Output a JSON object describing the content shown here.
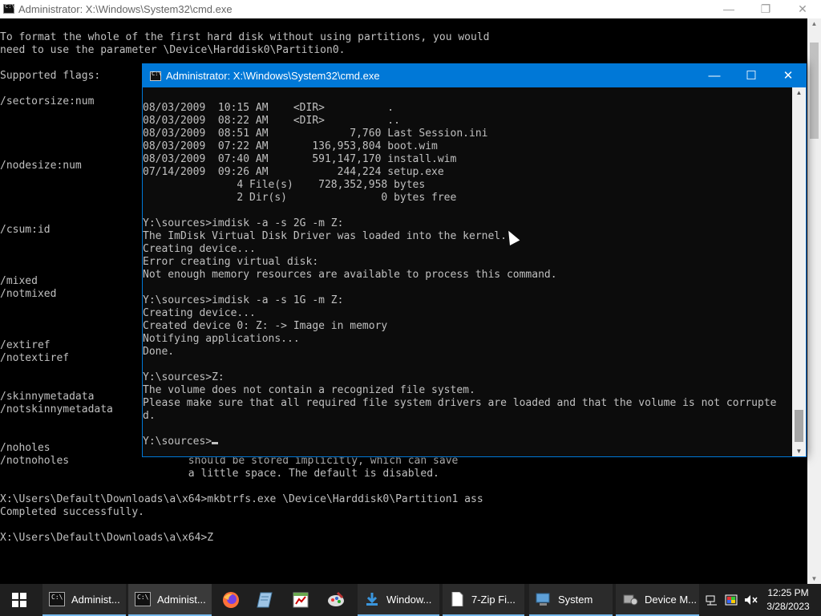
{
  "background_window": {
    "title": "Administrator: X:\\Windows\\System32\\cmd.exe",
    "lines": [
      "To format the whole of the first hard disk without using partitions, you would",
      "need to use the parameter \\Device\\Harddisk0\\Partition0.",
      "",
      "Supported flags:",
      "",
      "/sectorsize:num",
      "",
      "",
      "",
      "",
      "/nodesize:num",
      "",
      "",
      "",
      "",
      "/csum:id",
      "",
      "",
      "",
      "/mixed",
      "/notmixed",
      "",
      "",
      "",
      "/extiref",
      "/notextiref",
      "",
      "",
      "/skinnymetadata",
      "/notskinnymetadata",
      "",
      "",
      "/noholes",
      "/notnoholes                   should be stored implicitly, which can save",
      "                              a little space. The default is disabled.",
      "",
      "X:\\Users\\Default\\Downloads\\a\\x64>mkbtrfs.exe \\Device\\Harddisk0\\Partition1 ass",
      "Completed successfully.",
      "",
      "X:\\Users\\Default\\Downloads\\a\\x64>Z"
    ]
  },
  "foreground_window": {
    "title": "Administrator: X:\\Windows\\System32\\cmd.exe",
    "lines": [
      "08/03/2009  10:15 AM    <DIR>          .",
      "08/03/2009  08:22 AM    <DIR>          ..",
      "08/03/2009  08:51 AM             7,760 Last Session.ini",
      "08/03/2009  07:22 AM       136,953,804 boot.wim",
      "08/03/2009  07:40 AM       591,147,170 install.wim",
      "07/14/2009  09:26 AM           244,224 setup.exe",
      "               4 File(s)    728,352,958 bytes",
      "               2 Dir(s)               0 bytes free",
      "",
      "Y:\\sources>imdisk -a -s 2G -m Z:",
      "The ImDisk Virtual Disk Driver was loaded into the kernel.",
      "Creating device...",
      "Error creating virtual disk:",
      "Not enough memory resources are available to process this command.",
      "",
      "Y:\\sources>imdisk -a -s 1G -m Z:",
      "Creating device...",
      "Created device 0: Z: -> Image in memory",
      "Notifying applications...",
      "Done.",
      "",
      "Y:\\sources>Z:",
      "The volume does not contain a recognized file system.",
      "Please make sure that all required file system drivers are loaded and that the volume is not corrupte",
      "d.",
      ""
    ],
    "prompt": "Y:\\sources>"
  },
  "taskbar": {
    "apps": [
      {
        "label": "Administ...",
        "icon": "cmd-icon",
        "state": "open"
      },
      {
        "label": "Administ...",
        "icon": "cmd-icon",
        "state": "active"
      },
      {
        "label": "",
        "icon": "firefox-icon",
        "state": "pinned"
      },
      {
        "label": "",
        "icon": "notepad-icon",
        "state": "pinned"
      },
      {
        "label": "",
        "icon": "spreadsheet-icon",
        "state": "pinned"
      },
      {
        "label": "",
        "icon": "paint-icon",
        "state": "pinned"
      },
      {
        "label": "Window...",
        "icon": "download-icon",
        "state": "open"
      },
      {
        "label": "7-Zip Fi...",
        "icon": "document-icon",
        "state": "open"
      },
      {
        "label": "System",
        "icon": "system-icon",
        "state": "open"
      },
      {
        "label": "Device M...",
        "icon": "device-manager-icon",
        "state": "open"
      }
    ],
    "clock_time": "12:25 PM",
    "clock_date": "3/28/2023"
  }
}
